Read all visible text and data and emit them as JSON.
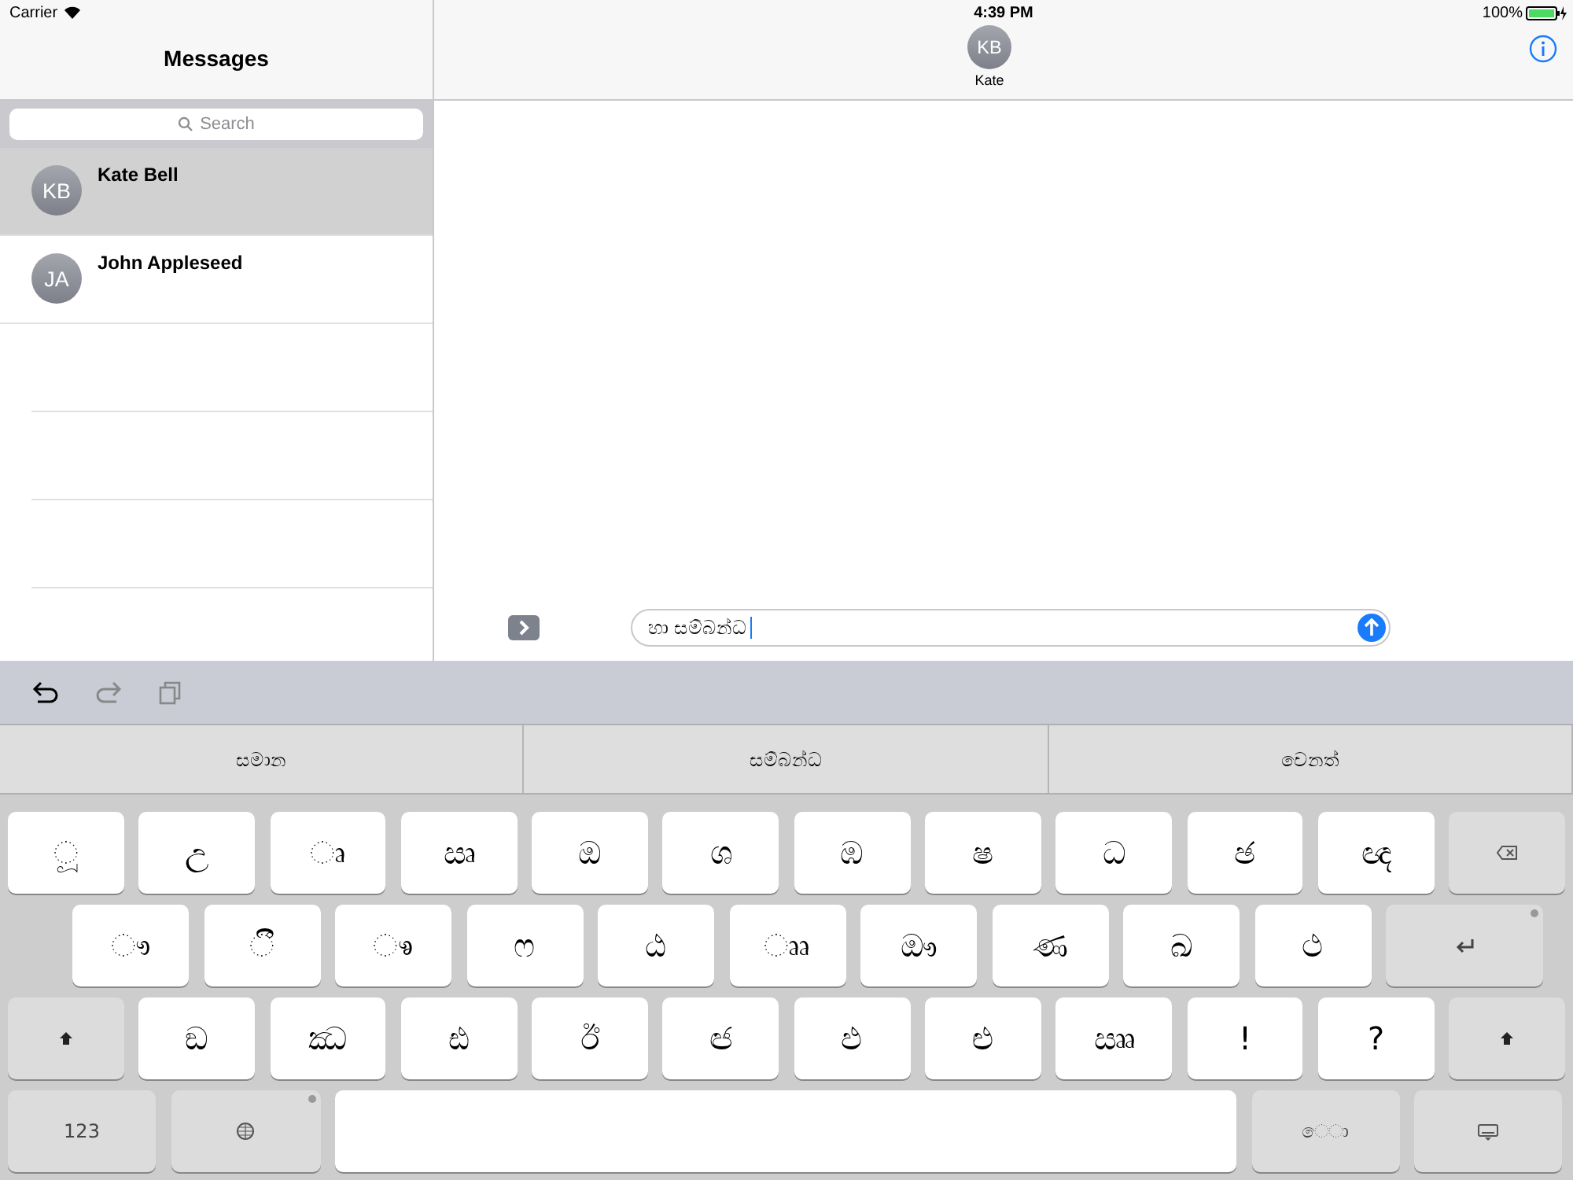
{
  "status_bar": {
    "carrier": "Carrier",
    "time": "4:39 PM",
    "battery": "100%"
  },
  "sidebar": {
    "title": "Messages",
    "search": {
      "placeholder": "Search"
    },
    "conversations": [
      {
        "initials": "KB",
        "name": "Kate Bell",
        "selected": true
      },
      {
        "initials": "JA",
        "name": "John Appleseed",
        "selected": false
      }
    ]
  },
  "conversation": {
    "initials": "KB",
    "name": "Kate",
    "composer": {
      "value": "හා සම්බන්ධ"
    }
  },
  "keyboard": {
    "suggestions": [
      "සමාන",
      "සම්බන්ධ",
      "වෙනත්"
    ],
    "rows": [
      [
        {
          "kind": "char",
          "label": "◌ූ"
        },
        {
          "kind": "char",
          "label": "උ"
        },
        {
          "kind": "char",
          "label": "◌ෘ"
        },
        {
          "kind": "char",
          "label": "ඍ"
        },
        {
          "kind": "char",
          "label": "ඔ"
        },
        {
          "kind": "char",
          "label": "ශ"
        },
        {
          "kind": "char",
          "label": "ඹ"
        },
        {
          "kind": "char",
          "label": "ෂ"
        },
        {
          "kind": "char",
          "label": "ධ"
        },
        {
          "kind": "char",
          "label": "ඡ"
        },
        {
          "kind": "char",
          "label": "ඥ"
        },
        {
          "kind": "delete"
        }
      ],
      [
        {
          "kind": "char",
          "label": "◌ෟ"
        },
        {
          "kind": "char",
          "label": "◌ී"
        },
        {
          "kind": "char",
          "label": "◌ෳ"
        },
        {
          "kind": "char",
          "label": "ෆ"
        },
        {
          "kind": "char",
          "label": "ඨ"
        },
        {
          "kind": "char",
          "label": "◌ෲ"
        },
        {
          "kind": "char",
          "label": "ඖ"
        },
        {
          "kind": "char",
          "label": "ණ"
        },
        {
          "kind": "char",
          "label": "ඛ"
        },
        {
          "kind": "char",
          "label": "ථ"
        },
        {
          "kind": "return"
        }
      ],
      [
        {
          "kind": "shift"
        },
        {
          "kind": "char",
          "label": "ඞ"
        },
        {
          "kind": "char",
          "label": "ඣ"
        },
        {
          "kind": "char",
          "label": "ඪ"
        },
        {
          "kind": "char",
          "label": "ඊ"
        },
        {
          "kind": "char",
          "label": "ඦ"
        },
        {
          "kind": "char",
          "label": "ඵ"
        },
        {
          "kind": "char",
          "label": "ළු"
        },
        {
          "kind": "char",
          "label": "ඎ"
        },
        {
          "kind": "char",
          "label": "!"
        },
        {
          "kind": "char",
          "label": "?"
        },
        {
          "kind": "shift"
        }
      ],
      [
        {
          "kind": "numbers",
          "label": "123"
        },
        {
          "kind": "globe"
        },
        {
          "kind": "space"
        },
        {
          "kind": "mode",
          "label": "ෙ◌ා"
        },
        {
          "kind": "hide"
        }
      ]
    ]
  }
}
